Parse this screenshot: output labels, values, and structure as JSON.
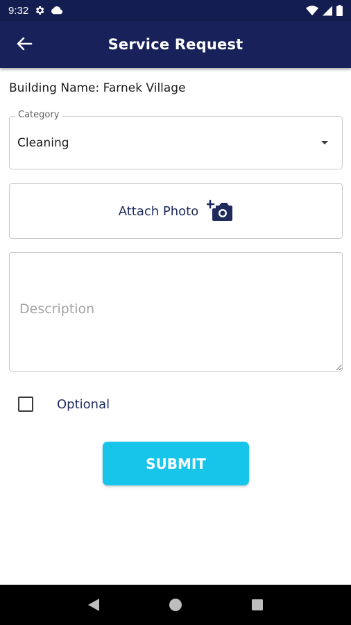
{
  "status_bar": {
    "time": "9:32",
    "icons": [
      "settings-icon",
      "cloud-icon",
      "wifi-icon",
      "signal-icon",
      "battery-icon"
    ]
  },
  "app_bar": {
    "title": "Service Request",
    "back_icon": "arrow-back-icon"
  },
  "building": {
    "label": "Building Name: Farnek Village"
  },
  "category": {
    "legend": "Category",
    "value": "Cleaning"
  },
  "attach": {
    "label": "Attach Photo",
    "icon": "add-camera-icon"
  },
  "description": {
    "placeholder": "Description",
    "value": ""
  },
  "optional": {
    "label": "Optional",
    "checked": false
  },
  "submit": {
    "label": "SUBMIT"
  },
  "colors": {
    "app_bar": "#18215a",
    "accent": "#17c4ea",
    "text_dark_blue": "#1e2a5c"
  }
}
